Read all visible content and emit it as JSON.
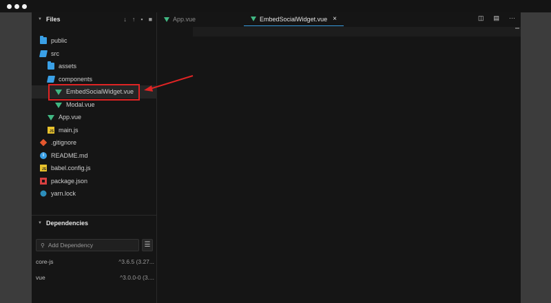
{
  "files_panel": {
    "title": "Files",
    "actions": [
      "↓",
      "↑",
      "▪",
      "■"
    ],
    "tree": [
      {
        "label": "public",
        "icon": "folder-icon",
        "depth": 0
      },
      {
        "label": "src",
        "icon": "folder-open-icon",
        "depth": 0
      },
      {
        "label": "assets",
        "icon": "folder-icon",
        "depth": 1
      },
      {
        "label": "components",
        "icon": "folder-open-icon",
        "depth": 1
      },
      {
        "label": "EmbedSocialWidget.vue",
        "icon": "vue-file-icon",
        "depth": 2,
        "selected": true
      },
      {
        "label": "Modal.vue",
        "icon": "vue-file-icon",
        "depth": 2
      },
      {
        "label": "App.vue",
        "icon": "vue-file-icon",
        "depth": 1
      },
      {
        "label": "main.js",
        "icon": "js-file-icon",
        "depth": 1
      },
      {
        "label": ".gitignore",
        "icon": "git-icon",
        "depth": 0
      },
      {
        "label": "README.md",
        "icon": "info-icon",
        "depth": 0
      },
      {
        "label": "babel.config.js",
        "icon": "js-file-icon",
        "depth": 0
      },
      {
        "label": "package.json",
        "icon": "npm-icon",
        "depth": 0
      },
      {
        "label": "yarn.lock",
        "icon": "yarn-icon",
        "depth": 0
      }
    ]
  },
  "dependencies_panel": {
    "title": "Dependencies",
    "search_placeholder": "Add Dependency",
    "menu_glyph": "☰",
    "items": [
      {
        "name": "core-js",
        "version": "^3.6.5 (3.27..."
      },
      {
        "name": "vue",
        "version": "^3.0.0-0 (3...."
      }
    ]
  },
  "editor": {
    "tabs": [
      {
        "label": "App.vue",
        "active": false
      },
      {
        "label": "EmbedSocialWidget.vue",
        "active": true,
        "close": "×"
      }
    ],
    "actions": [
      "split-editor-icon",
      "preview-icon",
      "more-icon"
    ],
    "more_glyph": "···"
  },
  "colors": {
    "accent": "#3aa0e6",
    "vue_green": "#41b883",
    "annotation_red": "#e02424"
  }
}
